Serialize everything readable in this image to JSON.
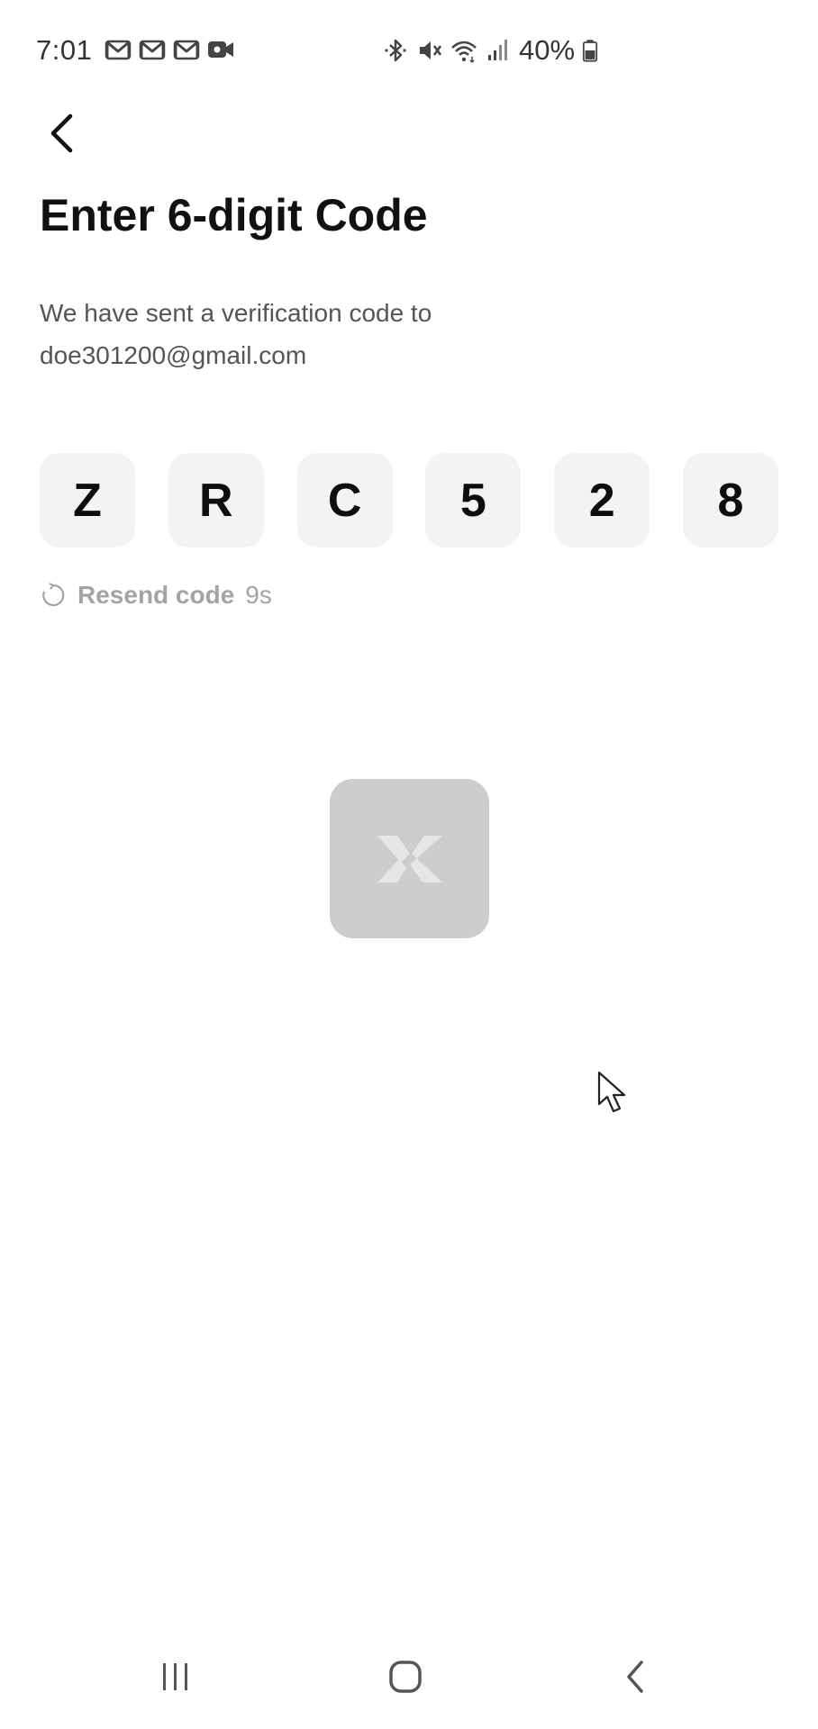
{
  "status_bar": {
    "time": "7:01",
    "left_icons": [
      "gmail-icon",
      "gmail-icon",
      "gmail-icon",
      "video-camera-icon"
    ],
    "right_icons": [
      "bluetooth-icon",
      "mute-icon",
      "wifi-icon",
      "signal-icon"
    ],
    "battery_percent": "40%"
  },
  "header": {
    "back_icon": "back-arrow-icon",
    "title": "Enter 6-digit Code"
  },
  "description": {
    "line1": "We have sent a verification code to",
    "email": "doe301200@gmail.com"
  },
  "code": {
    "digits": [
      "Z",
      "R",
      "C",
      "5",
      "2",
      "8"
    ]
  },
  "resend": {
    "icon": "refresh-icon",
    "label": "Resend code",
    "countdown": "9s"
  },
  "loader": {
    "icon": "app-logo-icon"
  },
  "nav_bar": {
    "icons": [
      "recent-apps-icon",
      "home-icon",
      "back-icon"
    ]
  },
  "colors": {
    "code_box_bg": "#f3f3f3",
    "loader_bg": "#cdcdcd",
    "muted_text": "#a4a4a4"
  }
}
